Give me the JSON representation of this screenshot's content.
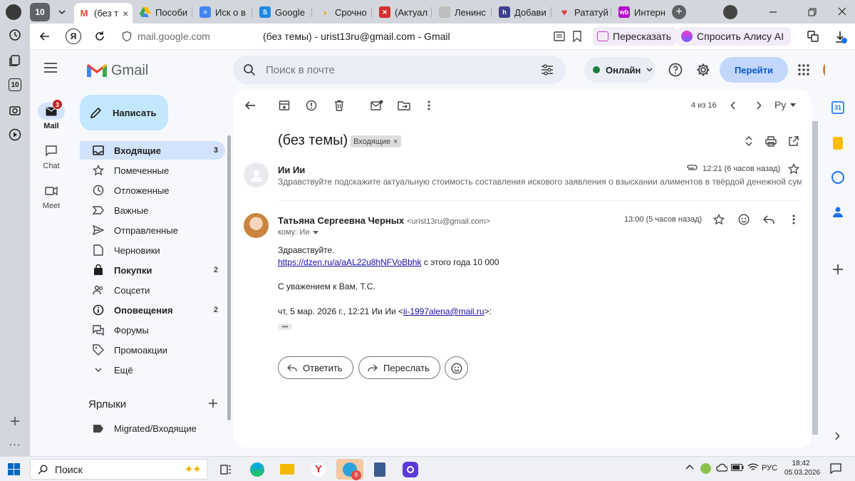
{
  "tabs": [
    {
      "label": "10",
      "fav_color": "#5f6368"
    },
    {
      "label": "(без т",
      "fav": "M",
      "fav_color": "#ea4335",
      "active": true
    },
    {
      "label": "Пособи",
      "fav_color": "#1a73e8"
    },
    {
      "label": "Иск о в",
      "fav_color": "#4285f4"
    },
    {
      "label": "Google",
      "fav_color": "#1e88e5"
    },
    {
      "label": "Срочно",
      "fav_color": "#f4a300"
    },
    {
      "label": "(Актуал",
      "fav_color": "#d32f2f"
    },
    {
      "label": "Ленинс",
      "fav_color": "#9e9e9e"
    },
    {
      "label": "Добави",
      "fav_color": "#3c3f8c"
    },
    {
      "label": "Рататуй",
      "fav_color": "#e53935"
    },
    {
      "label": "Интерн",
      "fav": "wb",
      "fav_color": "#b012c8"
    }
  ],
  "address": {
    "domain": "mail.google.com",
    "page_title": "(без темы) - urist13ru@gmail.com - Gmail",
    "retell_button": "Пересказать",
    "alice_button": "Спросить Алису AI"
  },
  "rail": {
    "mail_label": "Mail",
    "mail_badge": "3",
    "chat_label": "Chat",
    "meet_label": "Meet"
  },
  "header": {
    "logo_text": "Gmail",
    "search_placeholder": "Поиск в почте",
    "status": "Онлайн",
    "go_button": "Перейти"
  },
  "compose_label": "Написать",
  "nav": [
    {
      "label": "Входящие",
      "count": "3",
      "icon": "inbox-icon",
      "selected": true
    },
    {
      "label": "Помеченные",
      "count": "",
      "icon": "star-icon"
    },
    {
      "label": "Отложенные",
      "count": "",
      "icon": "clock-icon"
    },
    {
      "label": "Важные",
      "count": "",
      "icon": "important-icon"
    },
    {
      "label": "Отправленные",
      "count": "",
      "icon": "send-icon"
    },
    {
      "label": "Черновики",
      "count": "",
      "icon": "draft-icon"
    },
    {
      "label": "Покупки",
      "count": "2",
      "icon": "bag-icon",
      "bold": true
    },
    {
      "label": "Соцсети",
      "count": "",
      "icon": "people-icon"
    },
    {
      "label": "Оповещения",
      "count": "2",
      "icon": "info-icon",
      "bold": true
    },
    {
      "label": "Форумы",
      "count": "",
      "icon": "forum-icon"
    },
    {
      "label": "Промоакции",
      "count": "",
      "icon": "tag-icon"
    },
    {
      "label": "Ещё",
      "count": "",
      "icon": "chevron-down-icon"
    }
  ],
  "labels_heading": "Ярлыки",
  "labels": [
    {
      "label": "Migrated/Входящие"
    }
  ],
  "toolbar": {
    "pager": "4 из 16",
    "lang": "Ру"
  },
  "thread": {
    "subject": "(без темы)",
    "chip": "Входящие",
    "collapsed": {
      "sender": "Ии Ии",
      "time": "12:21 (6 часов назад)",
      "snippet": "Здравствуйте подскажите актуальную стоимость составления искового заявления о взыскании алиментов в твёрдой денежной сумме ..."
    },
    "message": {
      "sender": "Татьяна Сергеевна Черных",
      "email": "<urist13ru@gmail.com>",
      "to": "кому: Ии",
      "time": "13:00 (5 часов назад)",
      "greeting": "Здравствуйте.",
      "link": "https://dzen.ru/a/aAL22u8hNFVoBbhk",
      "link_tail": " с этого года 10 000",
      "signature": "С уважением к Вам, Т.С.",
      "quote_prefix": "чт, 5 мар. 2026 г., 12:21 Ии Ии <",
      "quote_email": "ii-1997alena@mail.ru",
      "quote_suffix": ">:",
      "ellipsis": "•••"
    },
    "reply_label": "Ответить",
    "forward_label": "Переслать"
  },
  "taskbar": {
    "search": "Поиск",
    "lang": "РУС",
    "time": "18:42",
    "date": "05.03.2026",
    "telegram_badge": "6"
  }
}
